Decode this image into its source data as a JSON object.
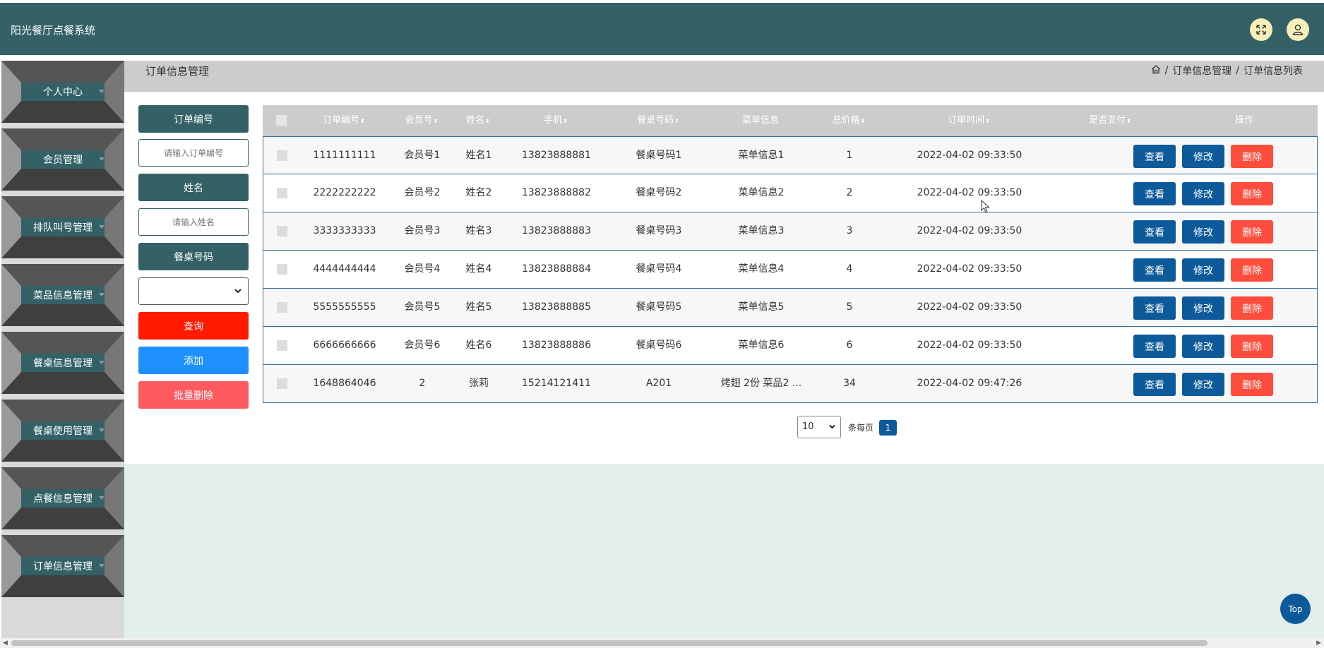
{
  "header": {
    "title": "阳光餐厅点餐系统",
    "fullscreen_icon": "expand-icon",
    "user_icon": "user-icon"
  },
  "sidebar": {
    "items": [
      {
        "label": "个人中心"
      },
      {
        "label": "会员管理"
      },
      {
        "label": "排队叫号管理"
      },
      {
        "label": "菜品信息管理"
      },
      {
        "label": "餐桌信息管理"
      },
      {
        "label": "餐桌使用管理"
      },
      {
        "label": "点餐信息管理"
      },
      {
        "label": "订单信息管理"
      }
    ]
  },
  "page": {
    "title": "订单信息管理",
    "breadcrumb": {
      "home_icon": "home-icon",
      "level1": "订单信息管理",
      "level2": "订单信息列表",
      "separator": "/"
    }
  },
  "search": {
    "order_no_label": "订单编号",
    "order_no_placeholder": "请输入订单编号",
    "name_label": "姓名",
    "name_placeholder": "请输入姓名",
    "table_no_label": "餐桌号码",
    "table_no_value": "",
    "query_label": "查询",
    "add_label": "添加",
    "batch_delete_label": "批量删除"
  },
  "table": {
    "columns": [
      "订单编号",
      "会员号",
      "姓名",
      "手机",
      "餐桌号码",
      "菜单信息",
      "总价格",
      "订单时间",
      "是否支付",
      "操作"
    ],
    "sort_icon": "sort-icon",
    "rows": [
      {
        "order_no": "1111111111",
        "member_no": "会员号1",
        "name": "姓名1",
        "phone": "13823888881",
        "table_no": "餐桌号码1",
        "menu": "菜单信息1",
        "total": "1",
        "time": "2022-04-02 09:33:50",
        "paid": ""
      },
      {
        "order_no": "2222222222",
        "member_no": "会员号2",
        "name": "姓名2",
        "phone": "13823888882",
        "table_no": "餐桌号码2",
        "menu": "菜单信息2",
        "total": "2",
        "time": "2022-04-02 09:33:50",
        "paid": ""
      },
      {
        "order_no": "3333333333",
        "member_no": "会员号3",
        "name": "姓名3",
        "phone": "13823888883",
        "table_no": "餐桌号码3",
        "menu": "菜单信息3",
        "total": "3",
        "time": "2022-04-02 09:33:50",
        "paid": ""
      },
      {
        "order_no": "4444444444",
        "member_no": "会员号4",
        "name": "姓名4",
        "phone": "13823888884",
        "table_no": "餐桌号码4",
        "menu": "菜单信息4",
        "total": "4",
        "time": "2022-04-02 09:33:50",
        "paid": ""
      },
      {
        "order_no": "5555555555",
        "member_no": "会员号5",
        "name": "姓名5",
        "phone": "13823888885",
        "table_no": "餐桌号码5",
        "menu": "菜单信息5",
        "total": "5",
        "time": "2022-04-02 09:33:50",
        "paid": ""
      },
      {
        "order_no": "6666666666",
        "member_no": "会员号6",
        "name": "姓名6",
        "phone": "13823888886",
        "table_no": "餐桌号码6",
        "menu": "菜单信息6",
        "total": "6",
        "time": "2022-04-02 09:33:50",
        "paid": ""
      },
      {
        "order_no": "1648864046",
        "member_no": "2",
        "name": "张莉",
        "phone": "15214121411",
        "table_no": "A201",
        "menu": "烤翅 2份 菜品2 ...",
        "total": "34",
        "time": "2022-04-02 09:47:26",
        "paid": ""
      }
    ],
    "actions": {
      "view": "查看",
      "edit": "修改",
      "delete": "删除"
    }
  },
  "pagination": {
    "page_size": "10",
    "per_page_label": "条每页",
    "current_page": "1"
  },
  "top_button": "Top",
  "colors": {
    "primary": "#336166",
    "action_blue": "#0d5a9a",
    "delete_red": "#ff4d3d",
    "query_red": "#ff1a00",
    "add_blue": "#1e90ff",
    "batch_delete": "#ff5a5f"
  }
}
